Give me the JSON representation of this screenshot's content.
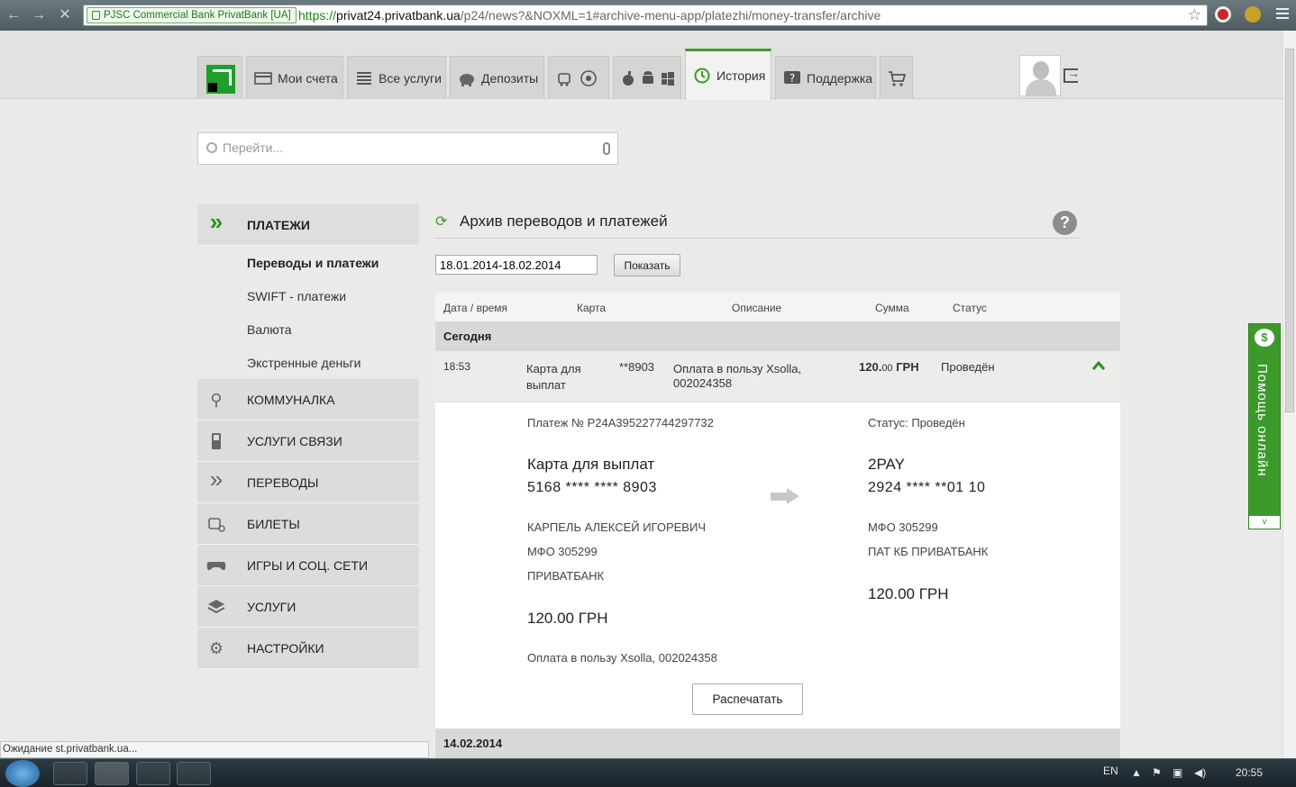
{
  "browser": {
    "ev_badge": "PJSC Commercial Bank PrivatBank [UA]",
    "url_scheme": "https://",
    "url_host": "privat24.privatbank.ua",
    "url_path": "/p24/news?&NOXML=1#archive-menu-app/platezhi/money-transfer/archive",
    "status_text": "Ожидание st.privatbank.ua..."
  },
  "topnav": {
    "tabs": [
      "Мои счета",
      "Все услуги",
      "Депозиты",
      "",
      "",
      "История",
      "Поддержка",
      ""
    ]
  },
  "search": {
    "placeholder": "Перейти..."
  },
  "sidebar": {
    "section_title": "ПЛАТЕЖИ",
    "sub_items": [
      "Переводы и платежи",
      "SWIFT - платежи",
      "Валюта",
      "Экстренные деньги"
    ],
    "items": [
      "КОММУНАЛКА",
      "УСЛУГИ СВЯЗИ",
      "ПЕРЕВОДЫ",
      "БИЛЕТЫ",
      "ИГРЫ И СОЦ. СЕТИ",
      "УСЛУГИ",
      "НАСТРОЙКИ"
    ]
  },
  "main": {
    "title": "Архив переводов и платежей",
    "help_label": "?",
    "date_range": "18.01.2014-18.02.2014",
    "show_button": "Показать",
    "columns": [
      "Дата / время",
      "Карта",
      "Описание",
      "Сумма",
      "Статус"
    ],
    "group_today": "Сегодня",
    "row": {
      "time": "18:53",
      "card_name_1": "Карта для",
      "card_name_2": "выплат",
      "card_mask": "**8903",
      "desc_1": "Оплата в пользу Xsolla,",
      "desc_2": "002024358",
      "amount_main": "120.",
      "amount_cents": "00",
      "amount_cur": "ГРН",
      "status": "Проведён"
    },
    "detail": {
      "payment_no": "Платеж № P24A395227744297732",
      "status_line": "Статус: Проведён",
      "from_title": "Карта для выплат",
      "from_number": "5168  ****  ****  8903",
      "from_owner": "КАРПЕЛЬ АЛЕКСЕЙ ИГОРЕВИЧ",
      "from_mfo": "МФО 305299",
      "from_bank": "ПРИВАТБАНК",
      "from_amount": "120.00 ГРН",
      "to_title": "2PAY",
      "to_number": "2924  ****  **01  10",
      "to_mfo": "МФО 305299",
      "to_bank": "ПАТ КБ ПРИВАТБАНК",
      "to_amount": "120.00  ГРН",
      "purpose": "Оплата в пользу Xsolla, 002024358",
      "print_button": "Распечатать"
    },
    "group_next": "14.02.2014"
  },
  "helper": {
    "label": "Помощь онлайн",
    "bubble": "$",
    "foot": "v"
  },
  "taskbar": {
    "lang": "EN",
    "time": "20:55"
  },
  "colors": {
    "brand_green": "#3c9a2a"
  }
}
